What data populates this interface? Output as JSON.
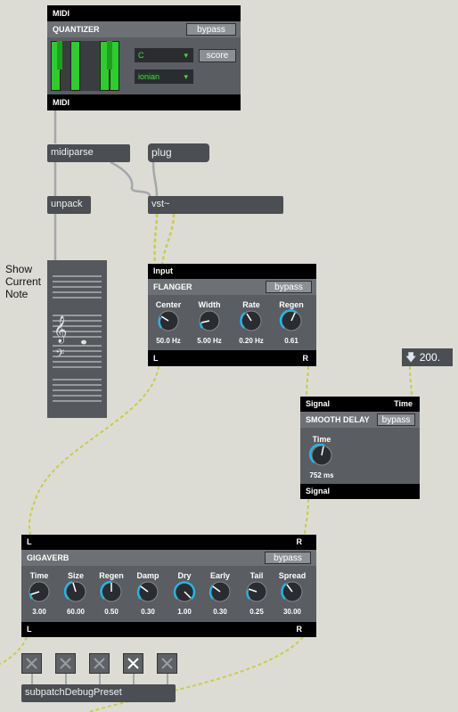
{
  "quantizer": {
    "top_bar": "MIDI",
    "title": "QUANTIZER",
    "bypass": "bypass",
    "key": "C",
    "scale": "ionian",
    "score_button": "score",
    "bottom_bar": "MIDI"
  },
  "objects": {
    "midiparse": "midiparse",
    "plug": "plug",
    "unpack": "unpack",
    "vst": "vst~",
    "subpatch": "subpatchDebugPreset"
  },
  "comment": {
    "line1": "Show",
    "line2": "Current",
    "line3": "Note"
  },
  "flanger": {
    "top_bar": "Input",
    "title": "FLANGER",
    "bypass": "bypass",
    "knobs": [
      {
        "label": "Center",
        "value": "50.0 Hz"
      },
      {
        "label": "Width",
        "value": "5.00 Hz"
      },
      {
        "label": "Rate",
        "value": "0.20 Hz"
      },
      {
        "label": "Regen",
        "value": "0.61"
      }
    ],
    "out_left": "L",
    "out_right": "R"
  },
  "number_box": {
    "value": "200."
  },
  "smooth_delay": {
    "top_left": "Signal",
    "top_right": "Time",
    "title": "SMOOTH DELAY",
    "bypass": "bypass",
    "knob": {
      "label": "Time",
      "value": "752 ms"
    },
    "bottom": "Signal"
  },
  "gigaverb": {
    "top_left": "L",
    "top_right": "R",
    "title": "GIGAVERB",
    "bypass": "bypass",
    "knobs": [
      {
        "label": "Time",
        "value": "3.00"
      },
      {
        "label": "Size",
        "value": "60.00"
      },
      {
        "label": "Regen",
        "value": "0.50"
      },
      {
        "label": "Damp",
        "value": "0.30"
      },
      {
        "label": "Dry",
        "value": "1.00"
      },
      {
        "label": "Early",
        "value": "0.30"
      },
      {
        "label": "Tail",
        "value": "0.25"
      },
      {
        "label": "Spread",
        "value": "30.00"
      }
    ],
    "bottom_left": "L",
    "bottom_right": "R"
  },
  "colors": {
    "canvas": "#dcdcd5",
    "accent_knob": "#27b4e6",
    "green": "#2ecc2e"
  }
}
